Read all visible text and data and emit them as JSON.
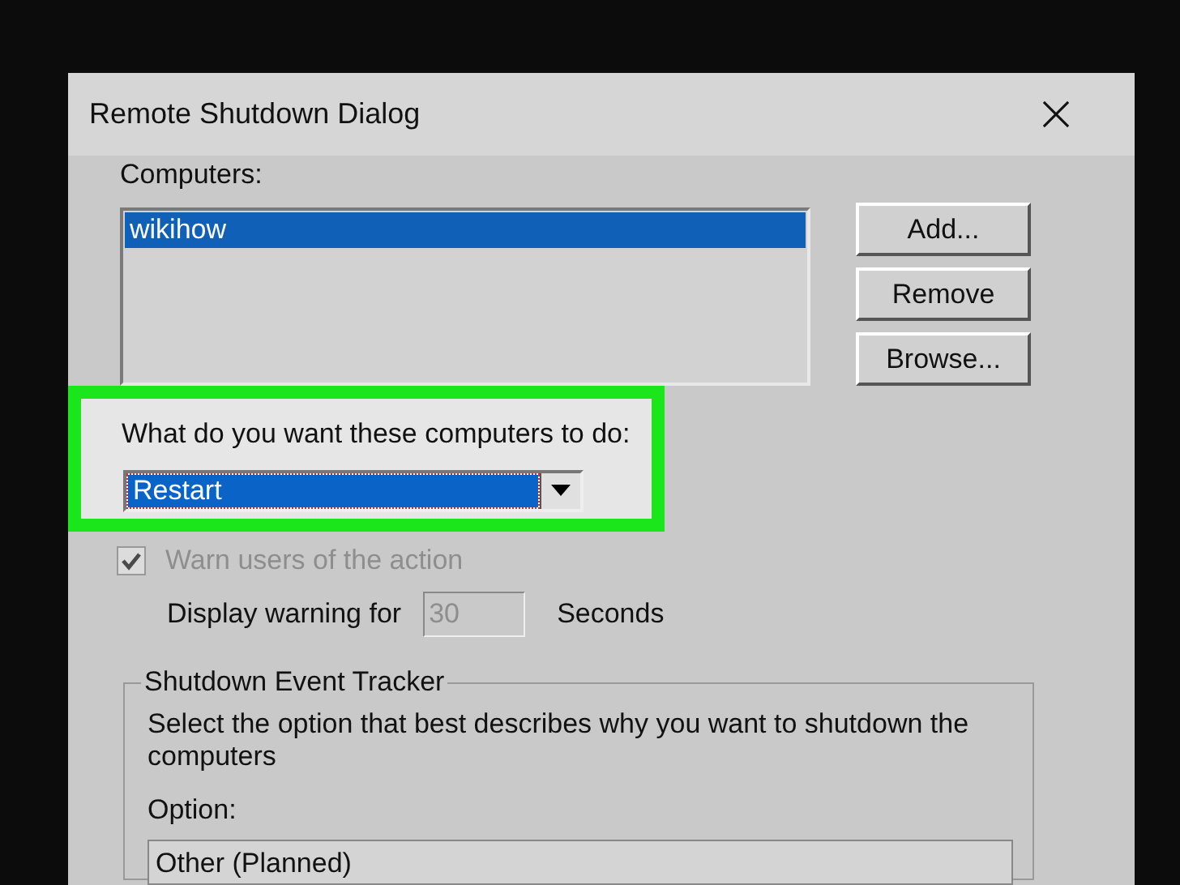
{
  "window": {
    "title": "Remote Shutdown Dialog"
  },
  "computers": {
    "label": "Computers:",
    "items": [
      {
        "name": "wikihow",
        "selected": true
      }
    ]
  },
  "buttons": [
    {
      "label": "Add..."
    },
    {
      "label": "Remove"
    },
    {
      "label": "Browse..."
    }
  ],
  "action": {
    "label": "What do you want these computers to do:",
    "value": "Restart",
    "highlighted": true
  },
  "warn": {
    "label": "Warn users of the action",
    "checked": true,
    "disabled": true
  },
  "delay": {
    "label": "Display warning for",
    "value": "30",
    "unit": "Seconds",
    "disabled": true
  },
  "tracker": {
    "title": "Shutdown Event Tracker",
    "description": "Select the option that best describes why you want to shutdown the computers",
    "option_label": "Option:",
    "option_value": "Other (Planned)"
  }
}
